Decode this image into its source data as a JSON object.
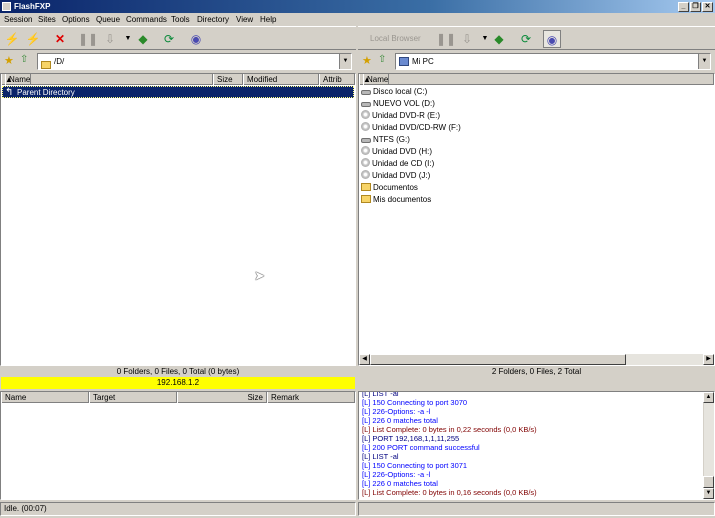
{
  "window": {
    "title": "FlashFXP",
    "minimize": "_",
    "restore": "❐",
    "close": "✕"
  },
  "menu": [
    "Session",
    "Sites",
    "Options",
    "Queue",
    "Commands",
    "Tools",
    "Directory",
    "View",
    "Help"
  ],
  "right_toolbar": {
    "local_browser": "Local Browser"
  },
  "left_pane": {
    "path": "/D/",
    "columns": {
      "name": "Name",
      "size": "Size",
      "modified": "Modified",
      "attrib": "Attrib"
    },
    "rows": [
      "Parent Directory"
    ],
    "status": "0 Folders, 0 Files, 0 Total (0 bytes)",
    "host": "192.168.1.2"
  },
  "right_pane": {
    "path": "Mi PC",
    "columns": {
      "name": "Name"
    },
    "rows": [
      {
        "label": "Disco local (C:)",
        "icon": "hard-drive-icon"
      },
      {
        "label": "NUEVO VOL (D:)",
        "icon": "hard-drive-icon"
      },
      {
        "label": "Unidad DVD-R (E:)",
        "icon": "cd-drive-icon"
      },
      {
        "label": "Unidad DVD/CD-RW (F:)",
        "icon": "cd-drive-icon"
      },
      {
        "label": "NTFS (G:)",
        "icon": "hard-drive-icon"
      },
      {
        "label": "Unidad DVD (H:)",
        "icon": "cd-drive-icon"
      },
      {
        "label": "Unidad de CD (I:)",
        "icon": "cd-drive-icon"
      },
      {
        "label": "Unidad DVD (J:)",
        "icon": "cd-drive-icon"
      },
      {
        "label": "Documentos",
        "icon": "folder-icon"
      },
      {
        "label": "Mis documentos",
        "icon": "folder-icon"
      }
    ],
    "status": "2 Folders, 0 Files, 2 Total"
  },
  "queue": {
    "columns": {
      "name": "Name",
      "target": "Target",
      "size": "Size",
      "remark": "Remark"
    }
  },
  "log": {
    "colors": {
      "command": "#000080",
      "server": "#0000ff",
      "status": "#800000"
    },
    "lines": [
      {
        "text": "[L] LIST -al",
        "kind": "command"
      },
      {
        "text": "[L] 150 Connecting to port 3070",
        "kind": "server"
      },
      {
        "text": "[L] 226-Options: -a -l",
        "kind": "server"
      },
      {
        "text": "[L] 226 0 matches total",
        "kind": "server"
      },
      {
        "text": "[L] List Complete: 0 bytes in 0,22 seconds (0,0 KB/s)",
        "kind": "status"
      },
      {
        "text": "[L] PORT 192,168,1,1,11,255",
        "kind": "command"
      },
      {
        "text": "[L] 200 PORT command successful",
        "kind": "server"
      },
      {
        "text": "[L] LIST -al",
        "kind": "command"
      },
      {
        "text": "[L] 150 Connecting to port 3071",
        "kind": "server"
      },
      {
        "text": "[L] 226-Options: -a -l",
        "kind": "server"
      },
      {
        "text": "[L] 226 0 matches total",
        "kind": "server"
      },
      {
        "text": "[L] List Complete: 0 bytes in 0,16 seconds (0,0 KB/s)",
        "kind": "status"
      }
    ]
  },
  "statusbar": {
    "text": "Idle. (00:07)"
  },
  "highlight_color": "#ffff00",
  "selection_color": "#0a246a"
}
